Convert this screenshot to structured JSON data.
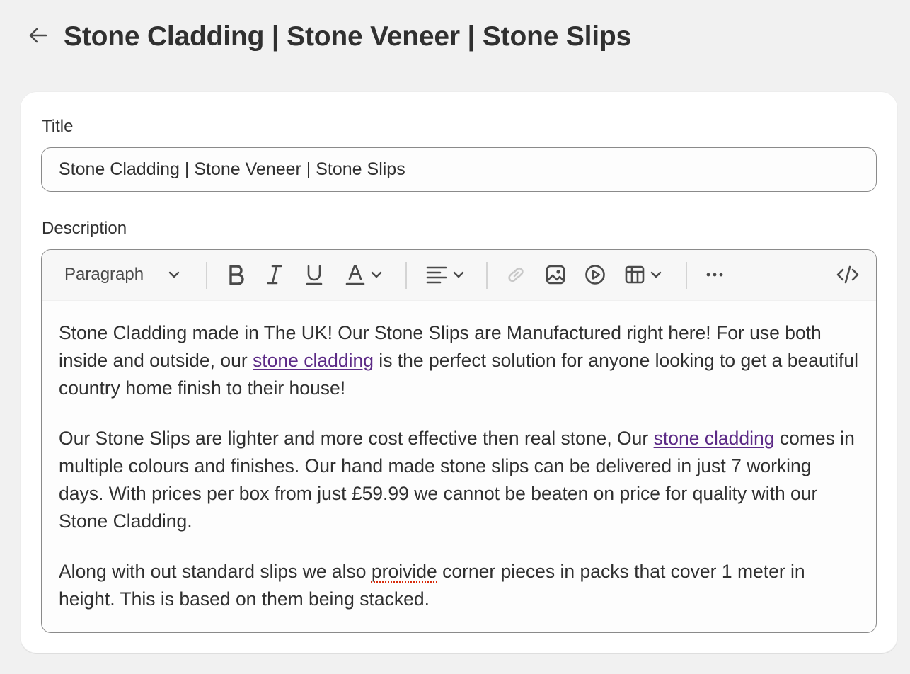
{
  "header": {
    "title": "Stone Cladding | Stone Veneer | Stone Slips",
    "back_icon": "arrow-left-icon"
  },
  "form": {
    "title_label": "Title",
    "title_value": "Stone Cladding | Stone Veneer | Stone Slips",
    "description_label": "Description"
  },
  "toolbar": {
    "paragraph_label": "Paragraph",
    "icons": [
      "bold-icon",
      "italic-icon",
      "underline-icon",
      "text-color-icon",
      "align-icon",
      "link-icon",
      "image-icon",
      "video-icon",
      "table-icon",
      "more-icon",
      "code-icon"
    ]
  },
  "description": {
    "p1_part1": "Stone Cladding made in The UK! Our Stone Slips are Manufactured right here! For use both inside and outside, our ",
    "p1_link": "stone cladding",
    "p1_part2": " is the perfect solution for anyone looking to get a beautiful country home finish to their house!",
    "p2_part1": "Our Stone Slips are lighter and more cost effective then real stone, Our ",
    "p2_link": "stone cladding",
    "p2_part2": " comes in multiple colours and finishes. Our hand made stone slips can be delivered in just 7 working days. With prices per box from just £59.99 we cannot be beaten on price for quality with our Stone Cladding.",
    "p3_part1": "Along with out standard slips we also ",
    "p3_misspelled": "proivide",
    "p3_part2": " corner pieces in packs that cover 1 meter in height. This is based on them being stacked."
  },
  "colors": {
    "background": "#f1f1f1",
    "card": "#ffffff",
    "link": "#5c2a86",
    "text": "#303030",
    "spellcheck": "#d72c0d"
  }
}
